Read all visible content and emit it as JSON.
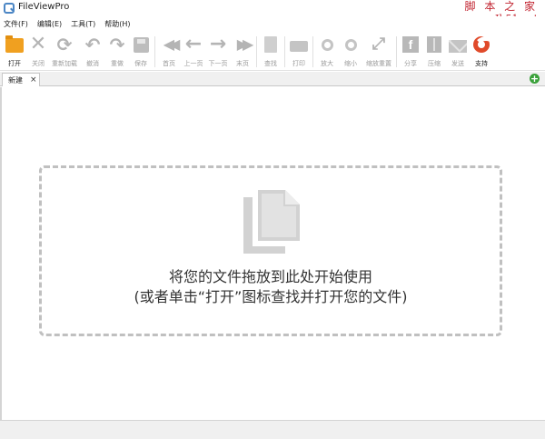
{
  "window": {
    "title": "FileViewPro"
  },
  "watermark": {
    "line1": "脚 本 之 家",
    "line2": "www.Jb51.net"
  },
  "menu": [
    {
      "label": "文件(F)"
    },
    {
      "label": "编辑(E)"
    },
    {
      "label": "工具(T)"
    },
    {
      "label": "帮助(H)"
    }
  ],
  "toolbar": {
    "open": "打开",
    "close": "关闭",
    "reload": "重新加载",
    "undo": "撤消",
    "redo": "重做",
    "save": "保存",
    "first": "首页",
    "prev": "上一页",
    "next": "下一页",
    "last": "末页",
    "find": "查找",
    "print": "打印",
    "zoom_in": "放大",
    "zoom_out": "缩小",
    "reset_zoom": "缩放重置",
    "share": "分享",
    "compress": "压缩",
    "send": "发送",
    "support": "支持"
  },
  "tabs": [
    {
      "label": "新建",
      "close": "×"
    }
  ],
  "add_tab": "+",
  "dropzone": {
    "line1": "将您的文件拖放到此处开始使用",
    "line2": "(或者单击“打开”图标查找并打开您的文件)"
  },
  "colors": {
    "accent_open": "#f0a020",
    "support": "#e04a2a",
    "add": "#3aa13a",
    "watermark": "#c1232f"
  }
}
